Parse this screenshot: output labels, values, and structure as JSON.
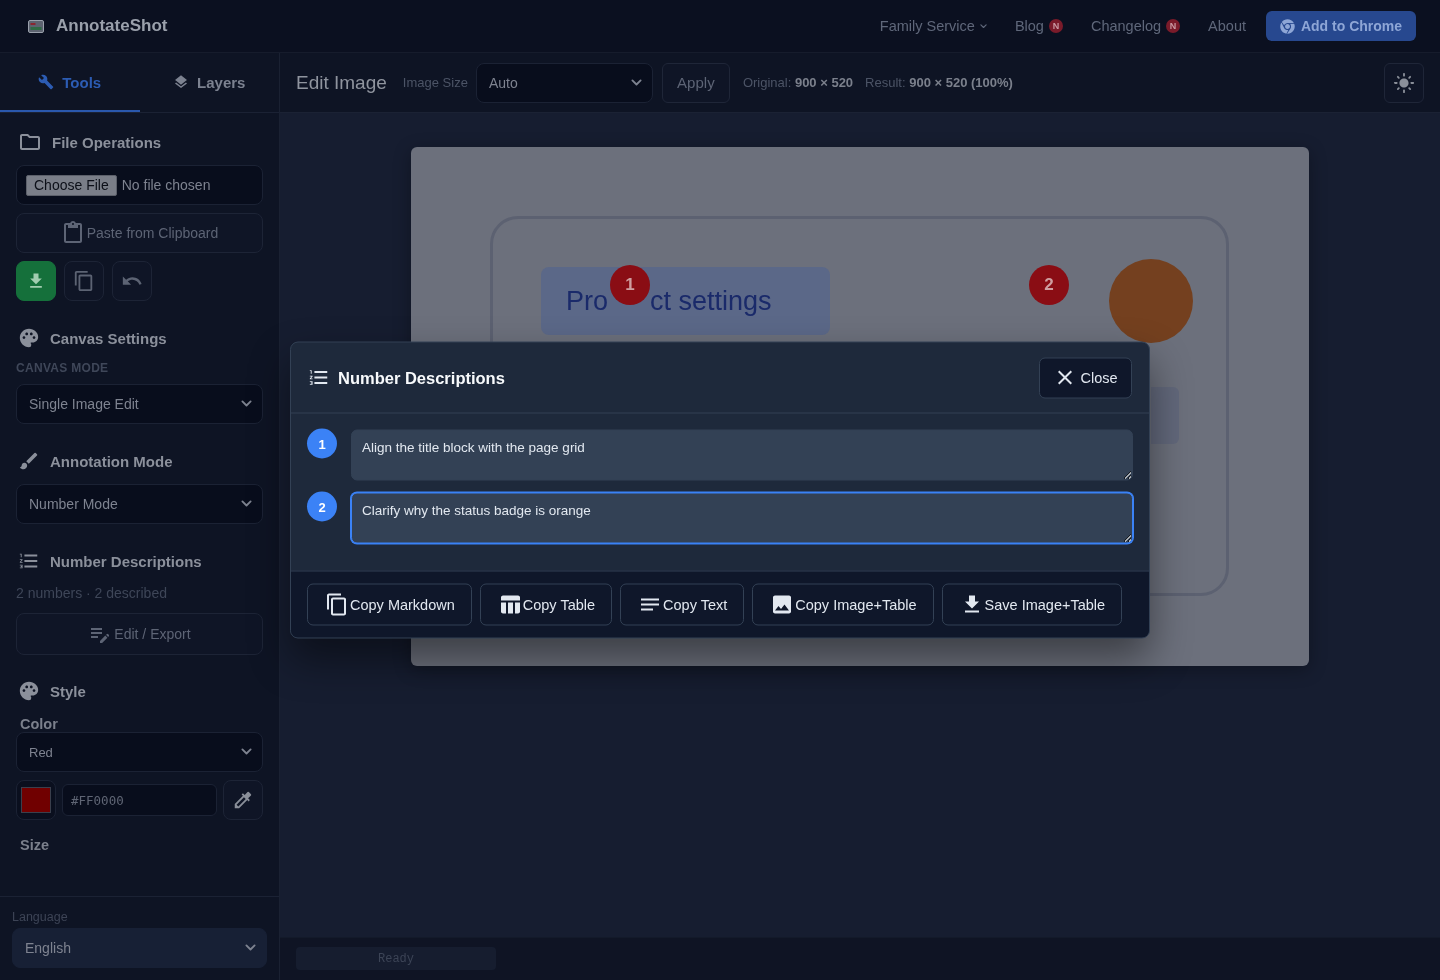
{
  "navbar": {
    "brand": "AnnotateShot",
    "links": [
      {
        "label": "Family Service",
        "kind": "dropdown"
      },
      {
        "label": "Blog",
        "kind": "badge",
        "badge": "N"
      },
      {
        "label": "Changelog",
        "kind": "badge",
        "badge": "N"
      },
      {
        "label": "About",
        "kind": "plain"
      }
    ],
    "cta": "Add to Chrome"
  },
  "sidebar": {
    "tabs": [
      {
        "label": "Tools",
        "selected": true
      },
      {
        "label": "Layers",
        "selected": false
      }
    ],
    "file_operations": {
      "title": "File Operations",
      "file_button": "Choose File",
      "file_status": "No file chosen",
      "paste_button": "Paste from Clipboard"
    },
    "canvas_settings": {
      "title": "Canvas Settings",
      "mode_label": "CANVAS MODE",
      "mode_value": "Single Image Edit"
    },
    "annotation_mode": {
      "title": "Annotation Mode",
      "value": "Number Mode"
    },
    "number_descriptions": {
      "title": "Number Descriptions",
      "summary": "2 numbers · 2 described",
      "button": "Edit / Export"
    },
    "style": {
      "title": "Style",
      "color_label": "Color",
      "color_value": "Red",
      "hex_value": "#FF0000",
      "size_label": "Size"
    },
    "language": {
      "label": "Language",
      "value": "English"
    }
  },
  "toolbar": {
    "title": "Edit Image",
    "size_label": "Image Size",
    "size_value": "Auto",
    "apply": "Apply",
    "original": "Original: **900 × 520**",
    "result": "Result: **900 × 520 (100%)**"
  },
  "canvas": {
    "mockup_title_parts": [
      "Pro",
      "ct settings"
    ],
    "markers": [
      {
        "number": "1"
      },
      {
        "number": "2"
      }
    ]
  },
  "status_bar": {
    "message": "Ready"
  },
  "modal": {
    "title": "Number Descriptions",
    "close": "Close",
    "items": [
      {
        "number": "1",
        "text": "Align the title block with the page grid",
        "focused": false
      },
      {
        "number": "2",
        "text": "Clarify why the status badge is orange",
        "focused": true
      }
    ],
    "actions": [
      {
        "label": "Copy Markdown",
        "kind": "copy"
      },
      {
        "label": "Copy Table",
        "kind": "table"
      },
      {
        "label": "Copy Text",
        "kind": "text"
      },
      {
        "label": "Copy Image+Table",
        "kind": "image"
      },
      {
        "label": "Save Image+Table",
        "kind": "download"
      }
    ]
  }
}
